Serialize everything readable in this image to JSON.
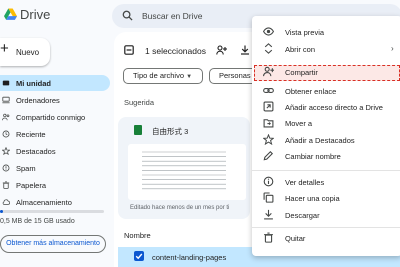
{
  "app": {
    "title": "Drive"
  },
  "search": {
    "placeholder": "Buscar en Drive"
  },
  "sidebar": {
    "new_label": "Nuevo",
    "items": [
      {
        "label": "Mi unidad",
        "icon": "my-drive-icon",
        "active": true
      },
      {
        "label": "Ordenadores",
        "icon": "computer-icon"
      },
      {
        "label": "Compartido conmigo",
        "icon": "shared-icon"
      },
      {
        "label": "Reciente",
        "icon": "clock-icon"
      },
      {
        "label": "Destacados",
        "icon": "star-icon"
      },
      {
        "label": "Spam",
        "icon": "spam-icon"
      },
      {
        "label": "Papelera",
        "icon": "trash-icon"
      },
      {
        "label": "Almacenamiento",
        "icon": "cloud-icon"
      }
    ],
    "storage_text": "0,5 MB de 15 GB usado",
    "storage_fraction": 0.03,
    "storage_button": "Obtener más almacenamiento"
  },
  "main": {
    "selection_count": "1 seleccionados",
    "chips": [
      "Tipo de archivo",
      "Personas"
    ],
    "suggested_title": "Sugerida",
    "card": {
      "title": "自由形式 3",
      "subtitle": "Editado hace menos de un mes por ti"
    },
    "column_header": "Nombre",
    "row_name": "content-landing-pages"
  },
  "menu": {
    "items": [
      {
        "label": "Vista previa",
        "icon": "eye-icon"
      },
      {
        "label": "Abrir con",
        "icon": "open-with-icon",
        "submenu": true
      },
      {
        "label": "Compartir",
        "icon": "person-add-icon",
        "highlighted": true
      },
      {
        "label": "Obtener enlace",
        "icon": "link-icon"
      },
      {
        "label": "Añadir acceso directo a Drive",
        "icon": "shortcut-icon"
      },
      {
        "label": "Mover a",
        "icon": "move-icon"
      },
      {
        "label": "Añadir a Destacados",
        "icon": "star-icon"
      },
      {
        "label": "Cambiar nombre",
        "icon": "edit-icon"
      },
      {
        "label": "Ver detalles",
        "icon": "info-icon"
      },
      {
        "label": "Hacer una copia",
        "icon": "copy-icon"
      },
      {
        "label": "Descargar",
        "icon": "download-icon"
      },
      {
        "label": "Quitar",
        "icon": "trash-icon"
      }
    ]
  },
  "colors": {
    "accent": "#0b57d0",
    "active_bg": "#c2e7ff",
    "highlight": "#d93025"
  }
}
